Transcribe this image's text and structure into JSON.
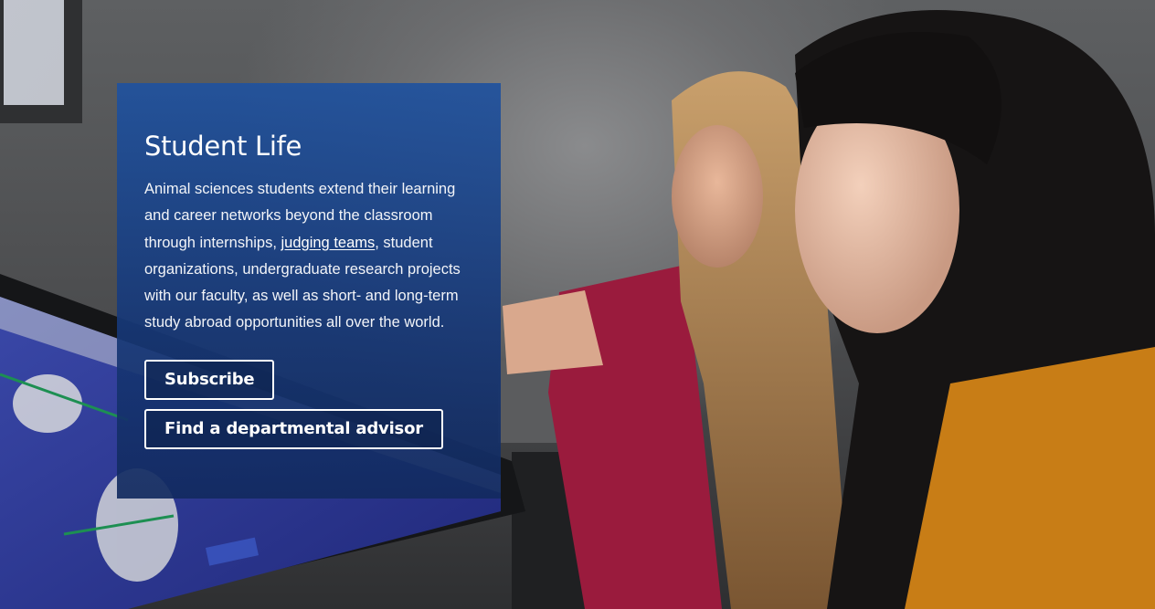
{
  "hero": {
    "title": "Student Life",
    "body_before_link": "Animal sciences students extend their learning and career networks beyond the classroom through internships, ",
    "body_link": "judging teams",
    "body_after_link": ", student organizations, undergraduate research projects with our faculty, as well as short- and long-term study abroad opportunities all over the world.",
    "buttons": [
      {
        "label": "Subscribe"
      },
      {
        "label": "Find a departmental advisor"
      }
    ],
    "panel_color": "#1f4e99"
  }
}
